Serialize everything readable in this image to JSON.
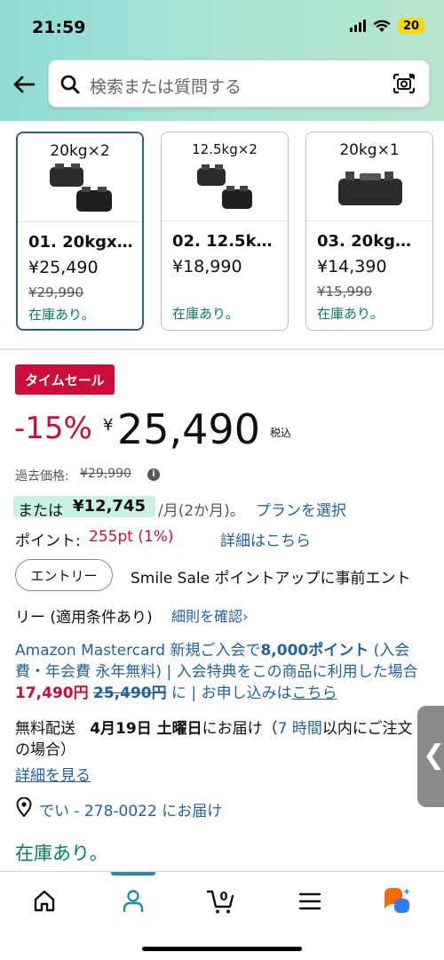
{
  "status_bar": {
    "time": "21:59",
    "battery": "20"
  },
  "search": {
    "placeholder": "検索または質問する"
  },
  "variations": [
    {
      "image_label": "20kg×2",
      "name": "01. 20kgx…",
      "price": "¥25,490",
      "old_price": "¥29,990",
      "stock": "在庫あり。",
      "selected": true
    },
    {
      "image_label": "12.5kg×2",
      "name": "02. 12.5k…",
      "price": "¥18,990",
      "old_price": "",
      "stock": "在庫あり。",
      "selected": false
    },
    {
      "image_label": "20kg×1",
      "name": "03. 20kg…",
      "price": "¥14,390",
      "old_price": "¥15,990",
      "stock": "在庫あり。",
      "selected": false
    }
  ],
  "deal": {
    "badge": "タイムセール",
    "discount": "-15%",
    "currency": "¥",
    "price": "25,490",
    "tax_label": "税込",
    "past_price_label": "過去価格:",
    "past_price": "¥29,990"
  },
  "installment": {
    "or_label": "または",
    "amount": "¥12,745",
    "period": "/月(2か月)。",
    "plan_link": "プランを選択"
  },
  "points": {
    "label": "ポイント:",
    "value": "255pt (1%)",
    "link": "詳細はこちら"
  },
  "smile_sale": {
    "entry_button": "エントリー",
    "line1": "Smile Sale ポイントアップに事前エント",
    "line2": "リー (適用条件あり)",
    "link": "細則を確認›"
  },
  "card_offer": {
    "part1": "Amazon Mastercard 新規ご入会で",
    "points": "8,000ポイント",
    "part2": " (入会費・年会費 永年無料) | 入会特典をこの商品に利用した場合",
    "discounted_price": "17,490円",
    "original_price": "25,490円",
    "part3": " に | お申し込みは",
    "link": "こちら"
  },
  "delivery": {
    "free_shipping": "無料配送",
    "date": "4月19日 土曜日",
    "suffix": "にお届け（",
    "hours": "7 時間",
    "order_within": "以内にご注文の場合）",
    "details_link": "詳細を見る"
  },
  "location": {
    "text": "でい - 278-0022 にお届け"
  },
  "stock_status": "在庫あり。",
  "side_tab": {
    "label": "❮"
  },
  "bottom_nav": {
    "cart_count": "0",
    "active_color": "#1f8ea8"
  }
}
